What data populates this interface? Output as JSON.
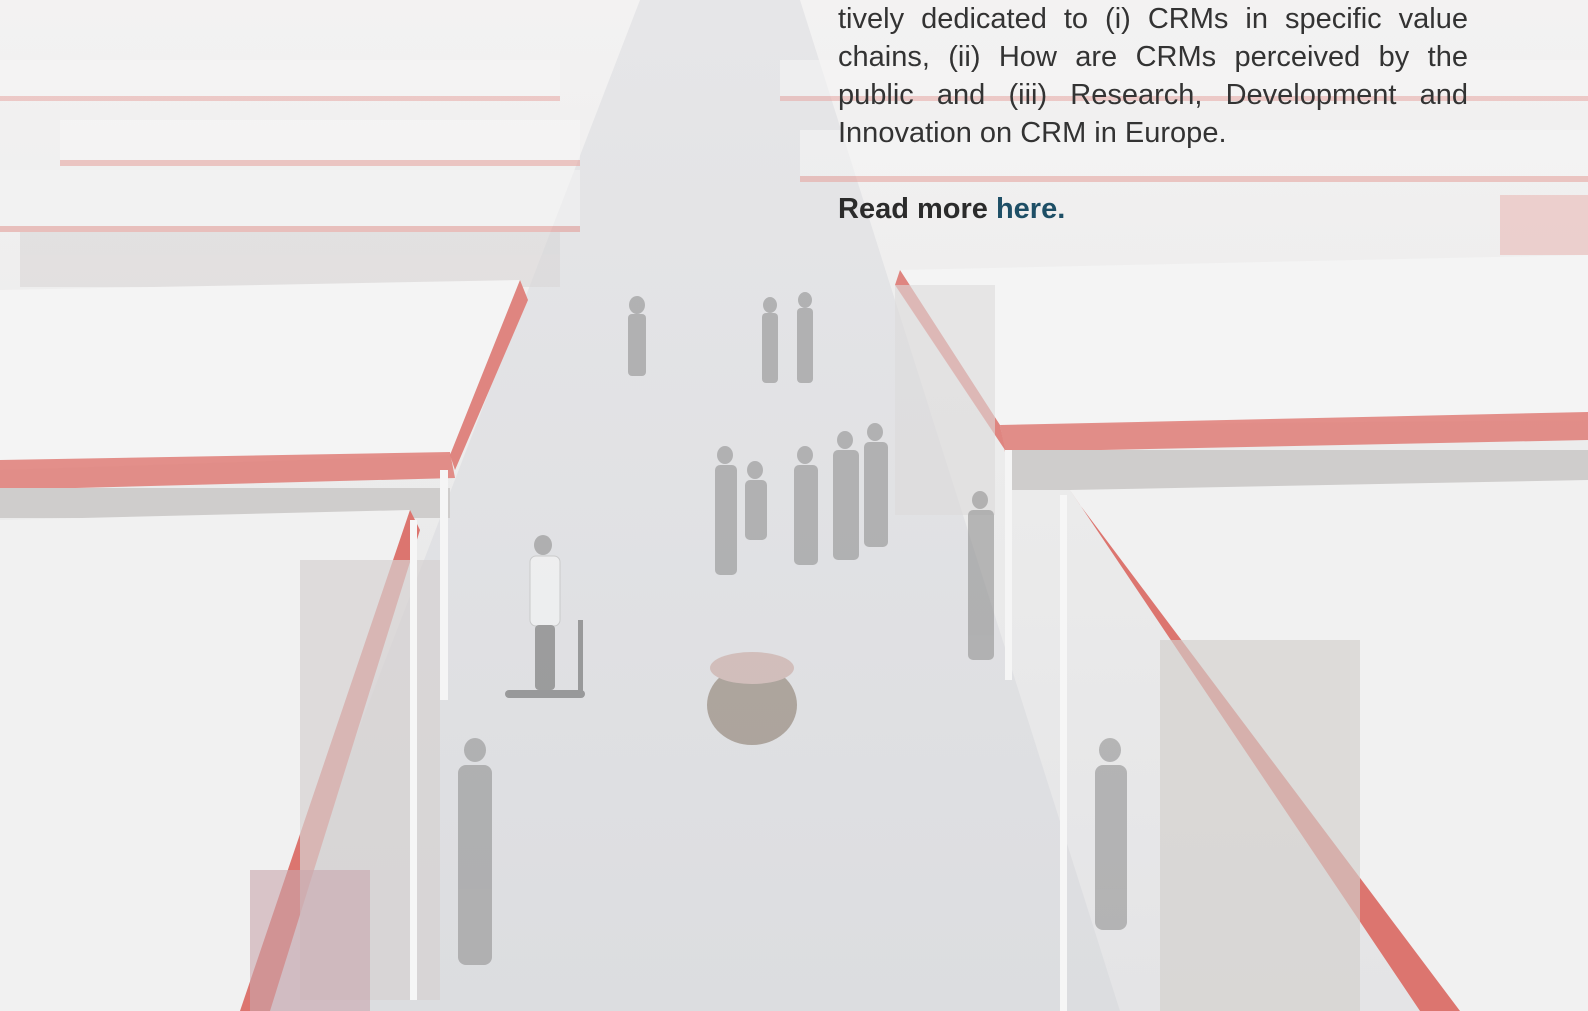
{
  "article": {
    "paragraph": "tively dedicated to (i) CRMs in specific value chains, (ii) How are CRMs perceived by the public and (iii) Research, Development and Innovation on CRM in Europe.",
    "read_more_label": "Read more",
    "read_more_link": "here."
  },
  "colors": {
    "accent_red": "#d9605a",
    "link_blue": "#1e4f66",
    "body_text": "#333333",
    "haze": "#ececec"
  }
}
